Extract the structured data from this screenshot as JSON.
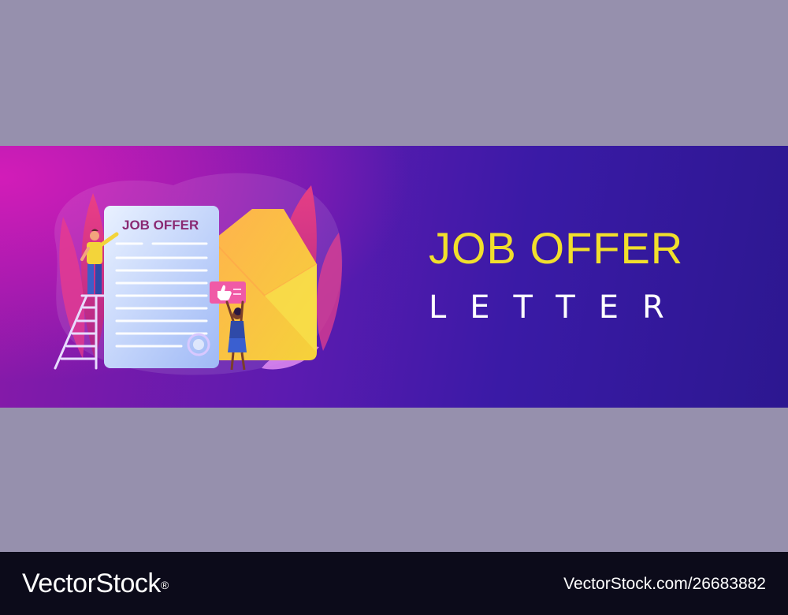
{
  "banner": {
    "document_heading": "JOB OFFER",
    "title_line1": "JOB OFFER",
    "title_line2": "LETTER"
  },
  "footer": {
    "brand": "VectorStock",
    "registered_mark": "®",
    "image_id": "VectorStock.com/26683882"
  },
  "colors": {
    "background_gray": "#9690ad",
    "banner_start": "#d21cb8",
    "banner_end": "#2c1790",
    "title_yellow": "#f1df2c",
    "footer_black": "#0c0b1a"
  },
  "icons": [
    "thumbs-up-icon",
    "seal-stamp-icon",
    "envelope-icon",
    "ladder-icon"
  ]
}
